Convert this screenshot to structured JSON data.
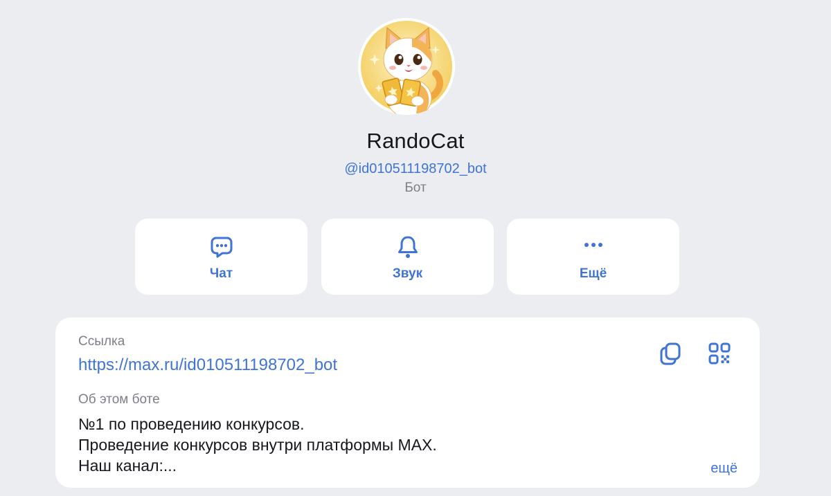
{
  "profile": {
    "name": "RandoCat",
    "handle": "@id010511198702_bot",
    "type": "Бот"
  },
  "actions": [
    {
      "label": "Чат",
      "icon": "chat-bubble-icon"
    },
    {
      "label": "Звук",
      "icon": "bell-icon"
    },
    {
      "label": "Ещё",
      "icon": "more-dots-icon"
    }
  ],
  "info": {
    "link_label": "Ссылка",
    "link_value": "https://max.ru/id010511198702_bot",
    "about_label": "Об этом боте",
    "about_lines": [
      "№1 по проведению конкурсов.",
      "Проведение конкурсов внутри платформы MAX.",
      "Наш канал:..."
    ],
    "more_label": "ещё",
    "icons": [
      "copy-icon",
      "qr-code-icon"
    ]
  },
  "colors": {
    "background": "#ebedf1",
    "card": "#ffffff",
    "accent": "#3f73d8",
    "text": "#15171c",
    "muted": "#7b7f88"
  }
}
